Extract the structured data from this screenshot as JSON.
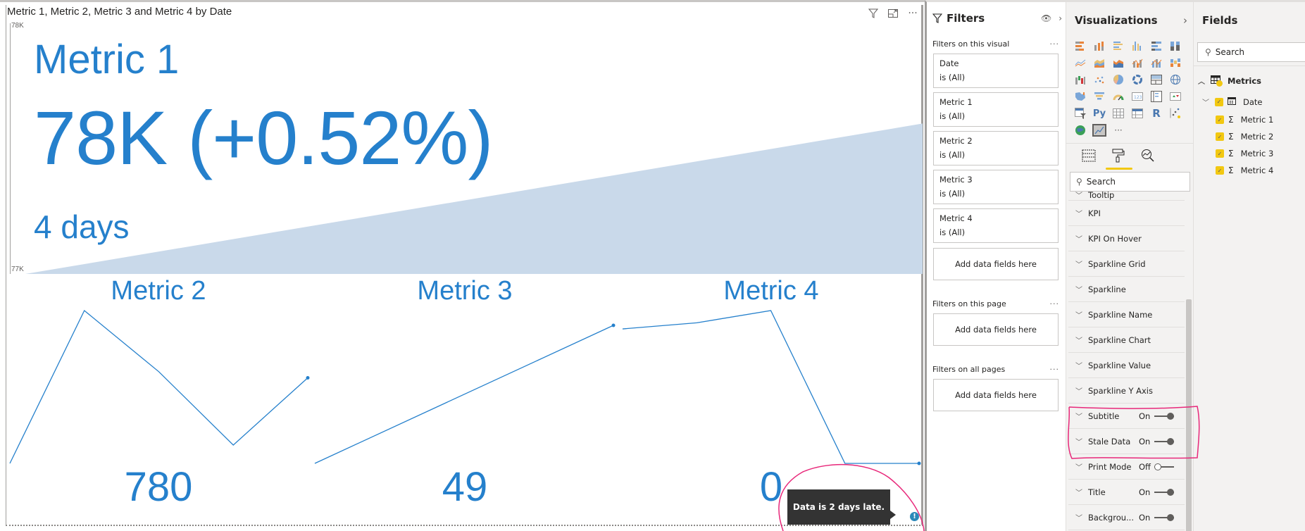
{
  "canvas": {
    "visual_title": "Metric 1, Metric 2, Metric 3 and Metric 4 by Date",
    "header_icons": [
      "filter-icon",
      "focus-mode-icon",
      "more-options-icon"
    ],
    "kpi": {
      "name": "Metric 1",
      "value": "78K",
      "change": "(+0.52%)",
      "subtitle": "4 days",
      "axis_max_label": "78K",
      "axis_min_label": "77K",
      "accent_color": "#2580cc",
      "area_color": "#c9d9ea"
    },
    "sparklines": [
      {
        "name": "Metric 2",
        "value": "780"
      },
      {
        "name": "Metric 3",
        "value": "49"
      },
      {
        "name": "Metric 4",
        "value": "0"
      }
    ],
    "stale_tooltip": "Data is 2 days late.",
    "stale_icon": "!"
  },
  "chart_data": [
    {
      "type": "area",
      "title": "Metric 1",
      "ylim": [
        77000,
        78000
      ],
      "ytick_labels": [
        "77K",
        "78K"
      ],
      "x": [
        1,
        2
      ],
      "values": [
        77000,
        77600
      ]
    },
    {
      "type": "line",
      "title": "Metric 2",
      "x": [
        1,
        2,
        3,
        4,
        5
      ],
      "values": [
        0.0,
        1.0,
        0.6,
        0.12,
        0.56
      ],
      "value_note": "relative sparkline shape; last value 780"
    },
    {
      "type": "line",
      "title": "Metric 3",
      "x": [
        1,
        2
      ],
      "values": [
        0.0,
        1.0
      ],
      "value_note": "relative sparkline shape; last value 49"
    },
    {
      "type": "line",
      "title": "Metric 4",
      "x": [
        1,
        2,
        3,
        4,
        5
      ],
      "values": [
        0.88,
        0.92,
        1.0,
        0.0,
        0.0
      ],
      "value_note": "relative sparkline shape; last value 0"
    }
  ],
  "filters": {
    "title": "Filters",
    "on_visual_label": "Filters on this visual",
    "on_page_label": "Filters on this page",
    "on_all_pages_label": "Filters on all pages",
    "more": "···",
    "cards": [
      {
        "name": "Date",
        "state": "is (All)"
      },
      {
        "name": "Metric 1",
        "state": "is (All)"
      },
      {
        "name": "Metric 2",
        "state": "is (All)"
      },
      {
        "name": "Metric 3",
        "state": "is (All)"
      },
      {
        "name": "Metric 4",
        "state": "is (All)"
      }
    ],
    "add_fields": "Add data fields here"
  },
  "visualizations": {
    "title": "Visualizations",
    "more_visuals": "···",
    "search_placeholder": "Search",
    "format_items": [
      {
        "label": "Tooltip",
        "state": "",
        "toggle": null
      },
      {
        "label": "KPI",
        "state": "",
        "toggle": null
      },
      {
        "label": "KPI On Hover",
        "state": "",
        "toggle": null
      },
      {
        "label": "Sparkline Grid",
        "state": "",
        "toggle": null
      },
      {
        "label": "Sparkline",
        "state": "",
        "toggle": null
      },
      {
        "label": "Sparkline Name",
        "state": "",
        "toggle": null
      },
      {
        "label": "Sparkline Chart",
        "state": "",
        "toggle": null
      },
      {
        "label": "Sparkline Value",
        "state": "",
        "toggle": null
      },
      {
        "label": "Sparkline Y Axis",
        "state": "",
        "toggle": null
      },
      {
        "label": "Subtitle",
        "state": "On",
        "toggle": "on"
      },
      {
        "label": "Stale Data",
        "state": "On",
        "toggle": "on"
      },
      {
        "label": "Print Mode",
        "state": "Off",
        "toggle": "off"
      },
      {
        "label": "Title",
        "state": "On",
        "toggle": "on"
      },
      {
        "label": "Backgrou...",
        "state": "On",
        "toggle": "on"
      }
    ]
  },
  "fields": {
    "title": "Fields",
    "search_placeholder": "Search",
    "table": "Metrics",
    "items": [
      {
        "label": "Date",
        "type": "calendar"
      },
      {
        "label": "Metric 1",
        "type": "sigma"
      },
      {
        "label": "Metric 2",
        "type": "sigma"
      },
      {
        "label": "Metric 3",
        "type": "sigma"
      },
      {
        "label": "Metric 4",
        "type": "sigma"
      }
    ]
  },
  "annotation_color": "#e8287a"
}
